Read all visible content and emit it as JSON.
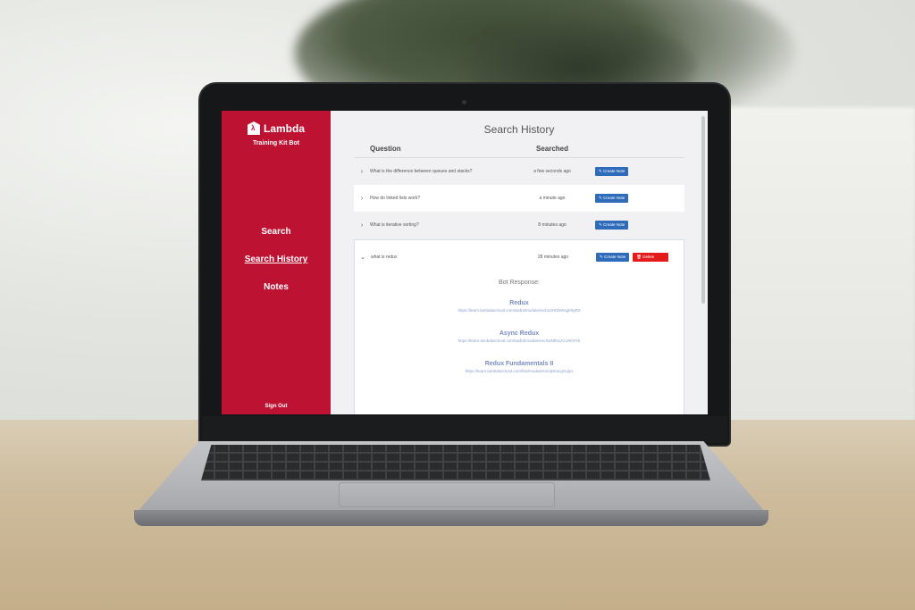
{
  "sidebar": {
    "brand": "Lambda",
    "brand_icon": "lambda-logo-icon",
    "subtitle": "Training Kit Bot",
    "nav": [
      "Search",
      "Search History",
      "Notes"
    ],
    "sign_out": "Sign Out"
  },
  "main": {
    "title": "Search History",
    "columns": {
      "question": "Question",
      "searched": "Searched"
    },
    "rows": [
      {
        "question": "What is the difference between queues and stacks?",
        "searched": "a few seconds ago"
      },
      {
        "question": "How do linked lists work?",
        "searched": "a minute ago"
      },
      {
        "question": "What is iterative sorting?",
        "searched": "8 minutes ago"
      },
      {
        "question": "what is redux",
        "searched": "28 minutes ago"
      }
    ],
    "create_note_label": "Create Note",
    "delete_label": "Delete",
    "bot_response_label": "Bot Response:",
    "responses": [
      {
        "title": "Redux",
        "link": "https://learn.lambdaschool.com/web3/module/recbo2HObWsgK9yR3"
      },
      {
        "title": "Async Redux",
        "link": "https://learn.lambdaschool.com/web3/module/recSwNfN1zCLRK9Yb"
      },
      {
        "title": "Redux Fundamentals II",
        "link": "https://learn.lambdaschool.com/fsw/module/recqDiracgGqlyx"
      }
    ]
  },
  "colors": {
    "sidebar": "#be1232",
    "note_button": "#2e6bb8",
    "delete_button": "#e41b1b"
  }
}
